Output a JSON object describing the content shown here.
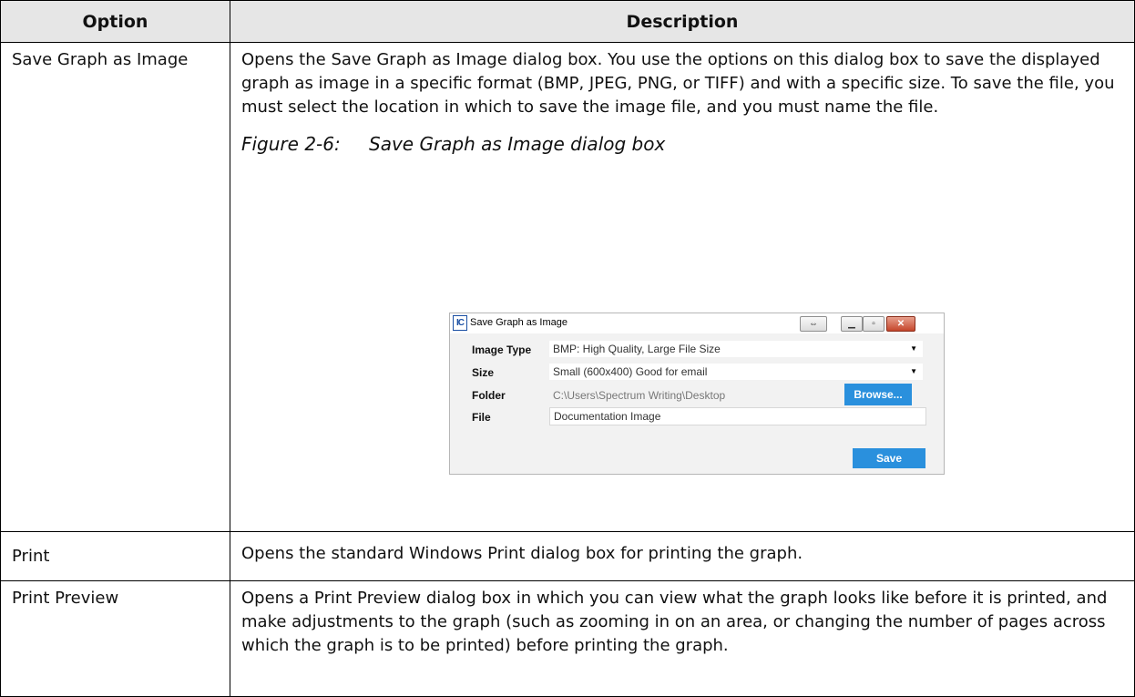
{
  "table": {
    "header_option": "Option",
    "header_description": "Description",
    "rows": [
      {
        "option": "Save Graph as Image",
        "description": "Opens the Save Graph as Image dialog box. You use the options on this dialog box to save the displayed graph as image in a specific format (BMP, JPEG, PNG, or TIFF) and with a specific size. To save the file, you must select the location in which to save the image file, and you must name the file."
      },
      {
        "option": "Print",
        "description": "Opens the standard Windows Print dialog box for printing the graph."
      },
      {
        "option": "Print Preview",
        "description": "Opens a Print Preview dialog box in which you can view what the graph looks like before it is printed, and make adjustments to the graph (such as zooming in on an area, or changing the number of pages across which the graph is to be printed) before printing the graph."
      }
    ]
  },
  "figure": {
    "number": "Figure 2-6:",
    "caption": "Save Graph as Image dialog box"
  },
  "dialog": {
    "app_icon": "IC",
    "title": "Save Graph as Image",
    "icons": {
      "restore": "double-arrow-icon",
      "minimize": "minimize-icon",
      "maximize": "maximize-icon",
      "close": "close-icon"
    },
    "image_type_label": "Image Type",
    "image_type_value": "BMP: High Quality, Large File Size",
    "size_label": "Size",
    "size_value": "Small (600x400) Good for email",
    "folder_label": "Folder",
    "folder_value": "C:\\Users\\Spectrum Writing\\Desktop",
    "browse_label": "Browse...",
    "file_label": "File",
    "file_value": "Documentation Image",
    "save_label": "Save",
    "colors": {
      "accent": "#2a90dd",
      "close": "#c5462b"
    }
  }
}
